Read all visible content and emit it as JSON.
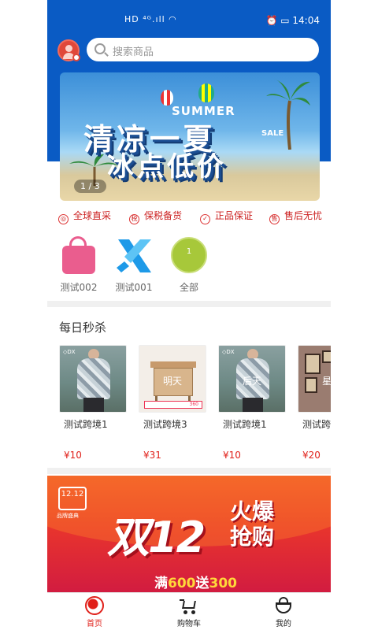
{
  "status_bar": {
    "left_icons": "HD ⁴ᴳ.ıll ◠",
    "right": "⏰ ▭ 14:04"
  },
  "search": {
    "placeholder": "搜索商品"
  },
  "banner": {
    "summer": "SUMMER",
    "sale": "SALE",
    "line1": "清凉一夏",
    "line2": "冰点低价",
    "indicator": "1 / 3"
  },
  "features": [
    {
      "label": "全球直采",
      "icon": "globe-icon"
    },
    {
      "label": "保税备货",
      "icon": "tax-icon"
    },
    {
      "label": "正品保证",
      "icon": "shield-icon"
    },
    {
      "label": "售后无忧",
      "icon": "service-icon"
    }
  ],
  "categories": [
    {
      "label": "测试002",
      "icon": "bag-icon"
    },
    {
      "label": "测试001",
      "icon": "x-logo-icon"
    },
    {
      "label": "全部",
      "icon": "all-circle-icon",
      "badge": "1"
    }
  ],
  "flash_sale": {
    "title": "每日秒杀",
    "items": [
      {
        "title": "测试跨境1",
        "price": "¥10",
        "overlay": ""
      },
      {
        "title": "测试跨境3",
        "price": "¥31",
        "overlay": "明天",
        "strip": "360"
      },
      {
        "title": "测试跨境1",
        "price": "¥10",
        "overlay": "后天"
      },
      {
        "title": "测试跨",
        "price": "¥20",
        "overlay": "星期"
      }
    ]
  },
  "promo": {
    "badge": "12.12",
    "badge_sub": "品牌盛典",
    "big": "双12",
    "hot_1": "火爆",
    "hot_2": "抢购",
    "offer_a": "满",
    "offer_b": "600",
    "offer_c": "送",
    "offer_d": "300"
  },
  "tabbar": [
    {
      "label": "首页",
      "active": true,
      "color": "#e0201a"
    },
    {
      "label": "购物车",
      "active": false,
      "color": "#222222"
    },
    {
      "label": "我的",
      "active": false,
      "color": "#222222"
    }
  ],
  "colors": {
    "brand_blue": "#0a5bc4",
    "accent_red": "#e0201a"
  }
}
